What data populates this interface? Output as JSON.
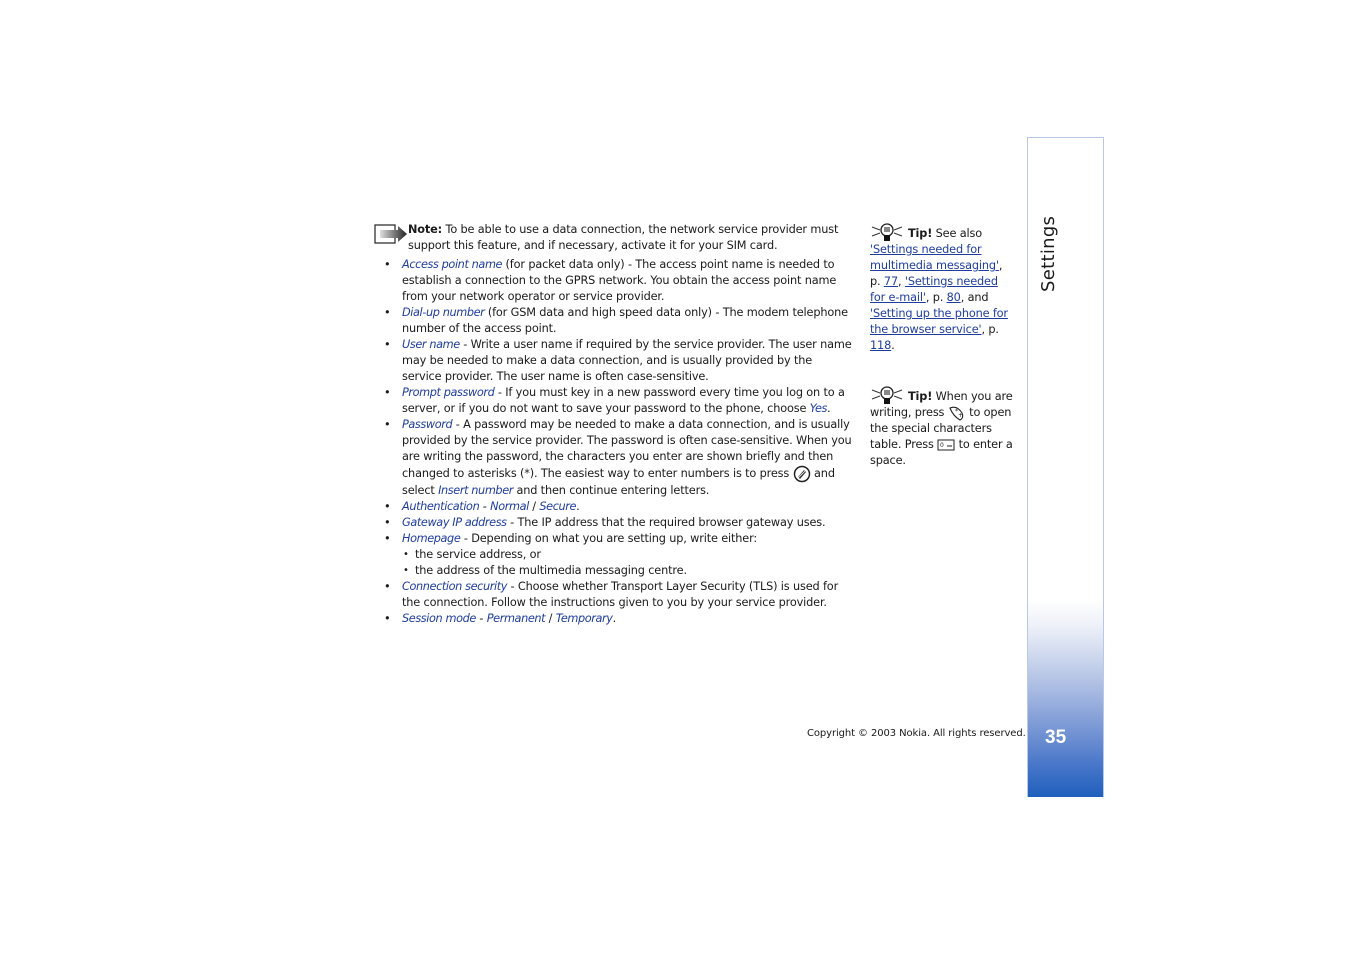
{
  "note": {
    "label": "Note:",
    "text": " To be able to use a data connection, the network service provider must support this feature, and if necessary, activate it for your SIM card."
  },
  "items": [
    {
      "term": "Access point name",
      "text": " (for packet data only) - The access point name is needed to establish a connection to the GPRS network. You obtain the access point name from your network operator or service provider."
    },
    {
      "term": "Dial-up number",
      "text": " (for GSM data and high speed data only) - The modem telephone number of the access point."
    },
    {
      "term": "User name",
      "text": " - Write a user name if required by the service provider. The user name may be needed to make a data connection, and is usually provided by the service provider. The user name is often case-sensitive."
    },
    {
      "term": "Prompt password",
      "text": " - If you must key in a new password every time you log on to a server, or if you do not want to save your password to the phone, choose ",
      "option": "Yes",
      "tail": "."
    },
    {
      "term": "Password",
      "text": " - A password may be needed to make a data connection, and is usually provided by the service provider. The password is often case-sensitive. When you are writing the password, the characters you enter are shown briefly and then changed to asterisks (*). The easiest way to enter numbers is to press ",
      "after_icon": " and select ",
      "option": "Insert number",
      "tail": " and then continue entering letters."
    },
    {
      "term": "Authentication",
      "sep": " - ",
      "option1": "Normal",
      "slash": " / ",
      "option2": "Secure",
      "tail": "."
    },
    {
      "term": "Gateway IP address",
      "text": " - The IP address that the required browser gateway uses."
    },
    {
      "term": "Homepage",
      "text": " - Depending on what you are setting up, write either:",
      "sub": [
        "the service address, or",
        "the address of the multimedia messaging centre."
      ]
    },
    {
      "term": "Connection security",
      "text": " - Choose whether Transport Layer Security (TLS) is used for the connection. Follow the instructions given to you by your service provider."
    },
    {
      "term": "Session mode",
      "sep": " - ",
      "option1": "Permanent",
      "slash": " / ",
      "option2": "Temporary",
      "tail": "."
    }
  ],
  "tips": [
    {
      "label": "Tip!",
      "intro": " See also ",
      "link1": "'Settings needed for multimedia messaging'",
      "p1": ", p. ",
      "page1": "77",
      "comma": ", ",
      "link2": "'Settings needed for e-mail'",
      "p2": ", p. ",
      "page2": "80",
      "and": ", and ",
      "link3": "'Setting up the phone for the browser service'",
      "p3": ", p. ",
      "page3": "118",
      "end": "."
    },
    {
      "label": "Tip!",
      "text1": " When you are writing, press ",
      "text2": " to open the special characters table. Press ",
      "text3": " to enter a space."
    }
  ],
  "section_tab": {
    "title": "Settings",
    "page_number": "35"
  },
  "footer": {
    "copyright": "Copyright © 2003 Nokia. All rights reserved."
  },
  "bullet": "•"
}
